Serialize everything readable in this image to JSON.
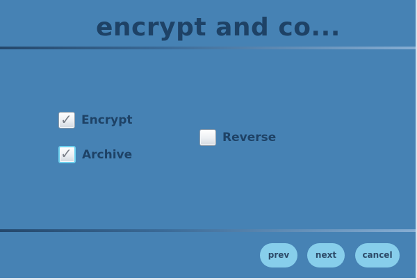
{
  "header": {
    "title": "encrypt and co..."
  },
  "options": {
    "encrypt": {
      "label": "Encrypt",
      "checked": true
    },
    "archive": {
      "label": "Archive",
      "checked": true,
      "focused": true
    },
    "reverse": {
      "label": "Reverse",
      "checked": false
    }
  },
  "footer": {
    "prev_label": "prev",
    "next_label": "next",
    "cancel_label": "cancel"
  },
  "colors": {
    "background": "#4682b4",
    "text": "#1e4266",
    "button": "#87ceeb",
    "focus_ring": "#6cd0ee"
  },
  "icons": {
    "check": "checkmark-icon"
  }
}
